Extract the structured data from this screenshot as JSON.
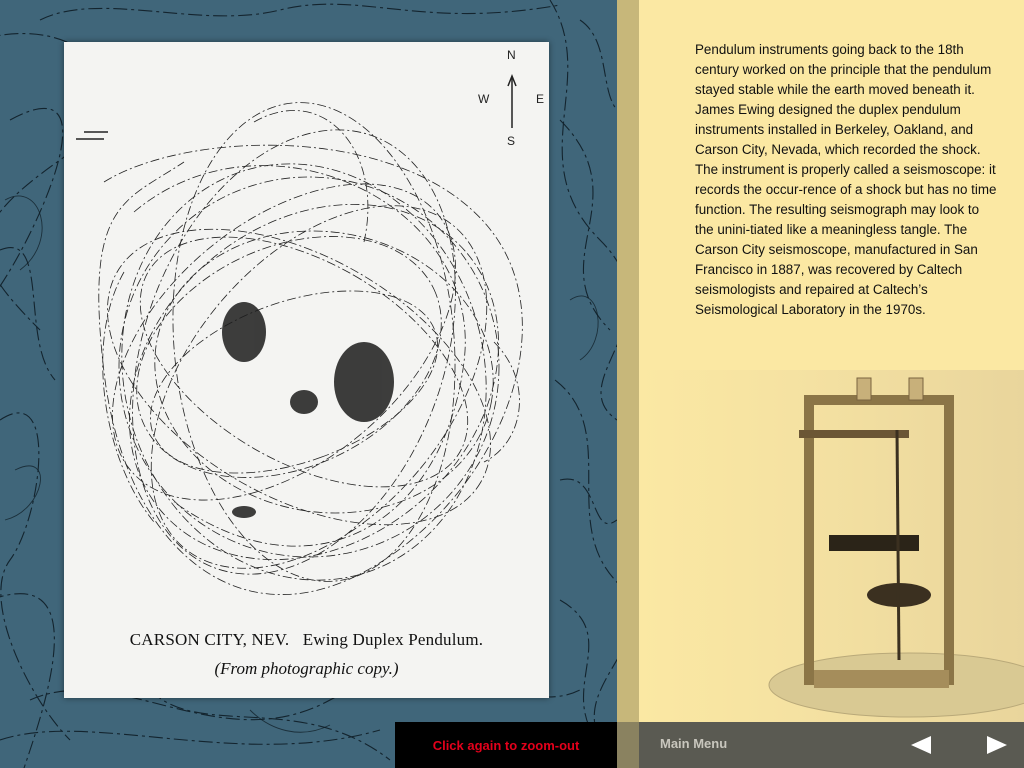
{
  "description": "Pendulum instruments going back to the 18th century worked on the principle that the pendulum stayed stable while the earth moved beneath it. James Ewing designed the duplex pendulum instruments installed in Berkeley, Oakland, and Carson City, Nevada, which recorded the shock. The instrument is properly called a seismoscope: it records the occur-rence of a shock but has no time function. The resulting seismograph may look to the unini-tiated like a meaningless tangle. The Carson City seismoscope, manufactured in San Francisco in 1887, was recovered by Caltech seismologists and repaired at Caltech’s Seismological Laboratory in the 1970s.",
  "figure": {
    "caption_line1": "CARSON CITY, NEV.   Ewing Duplex Pendulum.",
    "caption_line2": "(From photographic copy.)",
    "compass": {
      "north": "N",
      "south": "S",
      "west": "W",
      "east": "E"
    }
  },
  "controls": {
    "zoom_out_label": "Click again to zoom-out",
    "main_menu_label": "Main Menu",
    "prev_icon": "left-triangle-icon",
    "next_icon": "right-triangle-icon"
  },
  "colors": {
    "left_background": "#40667a",
    "right_background": "#fbe8a3",
    "zoom_text": "#e3001b",
    "bottom_bar": "#5a5a52"
  }
}
